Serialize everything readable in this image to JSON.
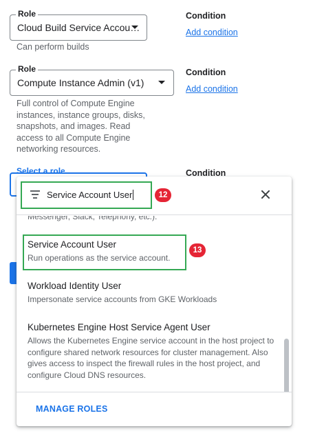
{
  "roles": [
    {
      "label": "Role",
      "value": "Cloud Build Service Accou…",
      "description": "Can perform builds"
    },
    {
      "label": "Role",
      "value": "Compute Instance Admin (v1)",
      "description": "Full control of Compute Engine instances, instance groups, disks, snapshots, and images. Read access to all Compute Engine networking resources."
    }
  ],
  "conditions": [
    {
      "title": "Condition",
      "link": "Add condition"
    },
    {
      "title": "Condition",
      "link": "Add condition"
    },
    {
      "title": "Condition"
    }
  ],
  "select_role": {
    "label": "Select a role"
  },
  "dropdown": {
    "search_value": "Service Account User",
    "search_icon": "filter-icon",
    "close_icon": "close-icon",
    "cut_text": "Messenger, Slack, Telephony, etc.).",
    "options": [
      {
        "title": "Service Account User",
        "description": "Run operations as the service account."
      },
      {
        "title": "Workload Identity User",
        "description": "Impersonate service accounts from GKE Workloads"
      },
      {
        "title": "Kubernetes Engine Host Service Agent User",
        "description": "Allows the Kubernetes Engine service account in the host project to configure shared network resources for cluster management. Also gives access to inspect the firewall rules in the host project, and configure Cloud DNS resources."
      }
    ],
    "manage_roles": "MANAGE ROLES"
  },
  "annotations": {
    "badge_search": "12",
    "badge_option": "13"
  },
  "colors": {
    "accent": "#1a73e8",
    "highlight": "#34a853",
    "badge": "#e52535"
  }
}
